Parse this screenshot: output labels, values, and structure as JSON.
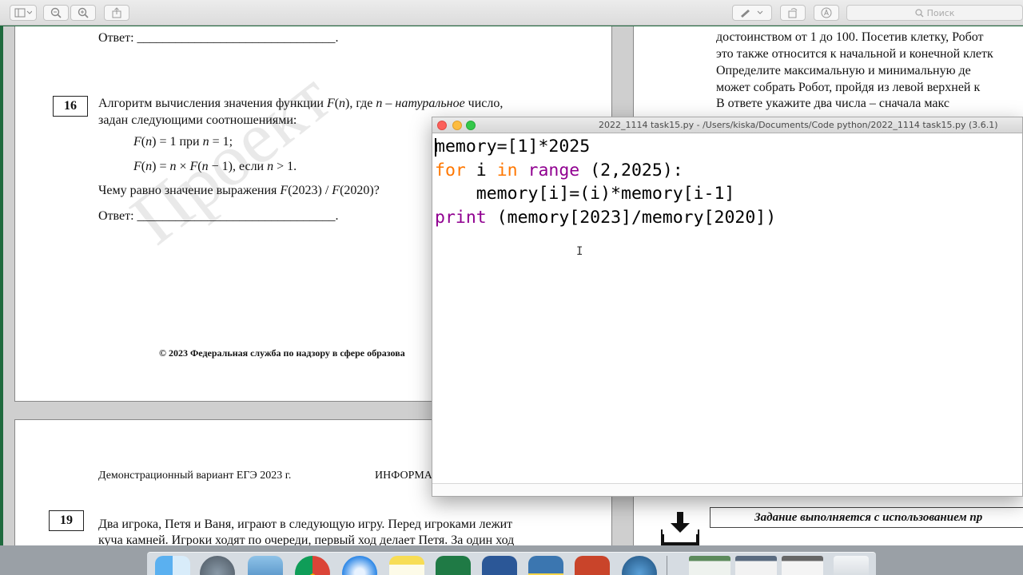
{
  "toolbar": {
    "search_placeholder": "Поиск",
    "buttons": [
      "sidebar-icon",
      "zoom-out-icon",
      "zoom-in-icon",
      "share-icon",
      "markup-icon",
      "rotate-icon",
      "annotate-icon"
    ]
  },
  "pdf": {
    "answer_label_top": "Ответ: ",
    "answer_line": "_______________________________.",
    "task16": {
      "number": "16",
      "line1_a": "Алгоритм вычисления значения функции ",
      "line1_fn": "F",
      "line1_b": "(",
      "line1_n": "n",
      "line1_c": "), где ",
      "line1_d": "n",
      "line1_e": " – ",
      "line1_f": "натуральное",
      "line1_g": " число,",
      "line2": "задан следующими соотношениями:",
      "rule1_a": "F",
      "rule1_b": "(",
      "rule1_c": "n",
      "rule1_d": ") = 1 при ",
      "rule1_e": "n",
      "rule1_f": " = 1;",
      "rule2_a": "F",
      "rule2_b": "(",
      "rule2_c": "n",
      "rule2_d": ") = ",
      "rule2_e": "n",
      "rule2_f": " × ",
      "rule2_g": "F",
      "rule2_h": "(",
      "rule2_i": "n",
      "rule2_j": " − 1), если ",
      "rule2_k": "n",
      "rule2_l": " > 1.",
      "question_a": "Чему равно значение выражения ",
      "question_b": "F",
      "question_c": "(2023) / ",
      "question_d": "F",
      "question_e": "(2020)?",
      "answer_label": "Ответ: "
    },
    "watermark": "Проект",
    "copyright": "© 2023 Федеральная служба по надзору в сфере образова",
    "page_header_left": "Демонстрационный вариант ЕГЭ 2023 г.",
    "page_header_right": "ИНФОРМА",
    "task19": {
      "number": "19",
      "line1": "Два игрока, Петя и Ваня, играют в следующую игру. Перед игроками лежит",
      "line2": "куча камней. Игроки ходят по очереди, первый ход делает Петя. За один ход"
    },
    "right_col": {
      "line1": "достоинством от 1 до 100. Посетив клетку, Робот",
      "line2": "это также относится к начальной и конечной клетк",
      "line3": "Определите  максимальную  и  минимальную  де",
      "line4": "может собрать Робот, пройдя из левой верхней к",
      "line5": "В ответе   укажите   два   числа   –   сначала   макс"
    },
    "banner": "Задание выполняется с использованием пр"
  },
  "idle": {
    "title": "2022_1114 task15.py - /Users/kiska/Documents/Code python/2022_1114 task15.py (3.6.1)",
    "code": {
      "l1": "memory=[1]*2025",
      "l2_kw1": "for",
      "l2_a": " i ",
      "l2_kw2": "in",
      "l2_b": " ",
      "l2_bi": "range",
      "l2_c": " (2,2025):",
      "l3": "    memory[i]=(i)*memory[i-1]",
      "l4_bi": "print",
      "l4_a": " (memory[2023]/memory[2020])"
    }
  },
  "colors": {
    "keyword": "#ff7700",
    "builtin": "#900090",
    "desktop": "#1f6a3e"
  },
  "dock": {
    "icons": [
      "finder-icon",
      "launchpad-icon",
      "preview-icon",
      "chrome-icon",
      "safari-icon",
      "notes-icon",
      "excel-icon",
      "word-icon",
      "python-idle-icon",
      "powerpoint-icon",
      "quicktime-icon",
      "screenshot-thumb-icon",
      "screenshot-thumb-icon",
      "screenshot-thumb-icon",
      "trash-icon"
    ]
  }
}
